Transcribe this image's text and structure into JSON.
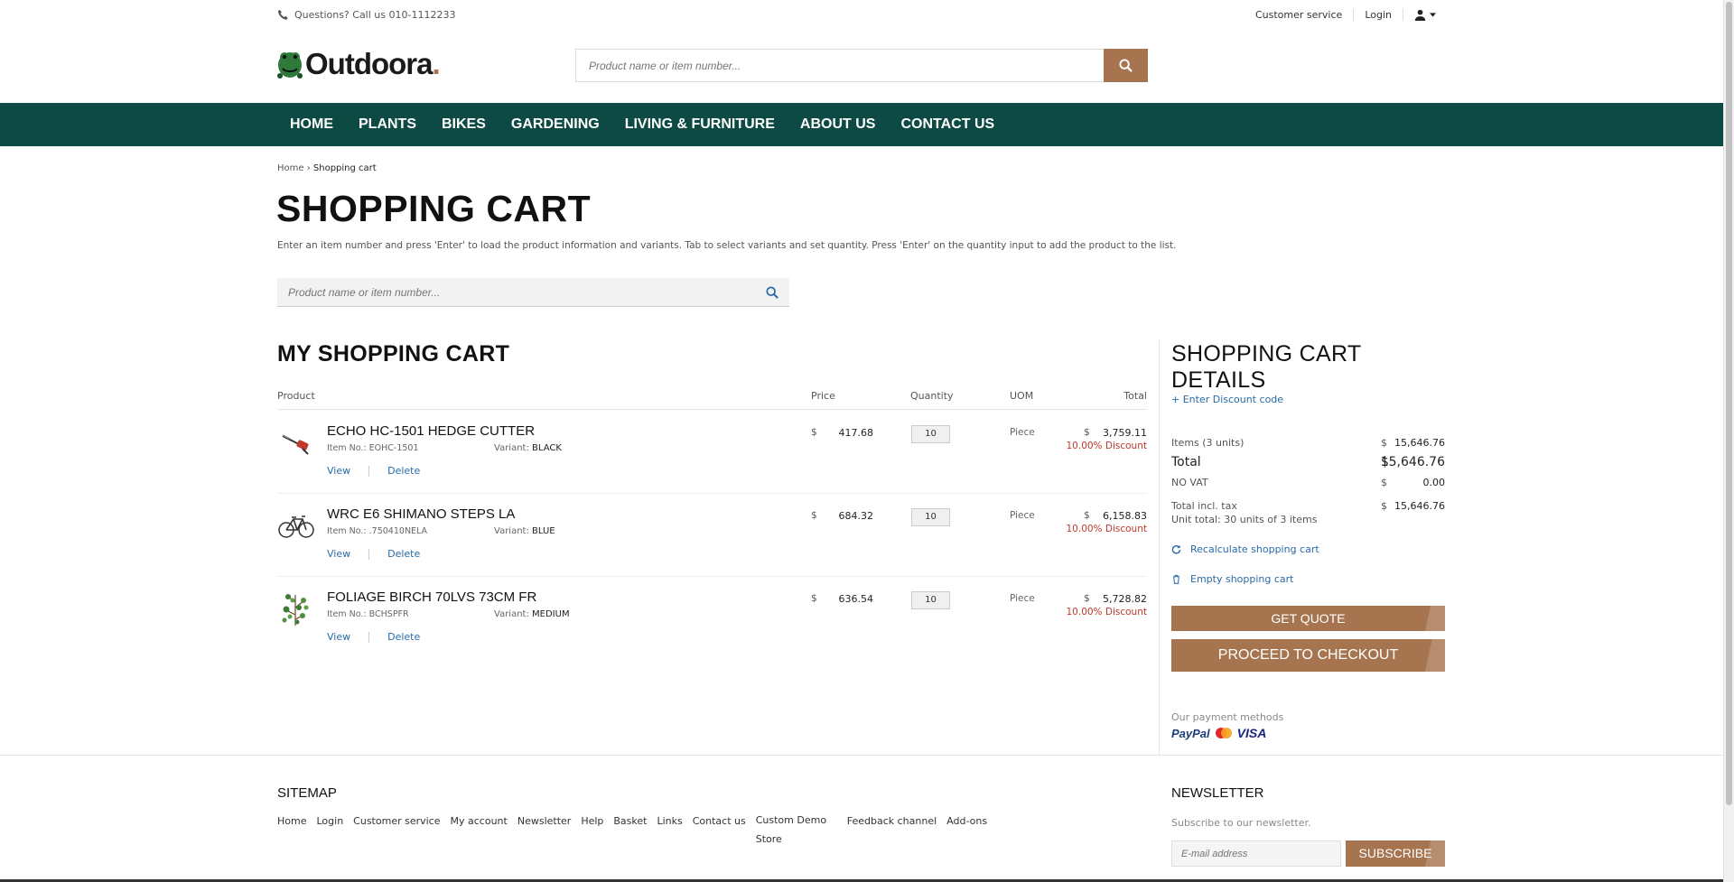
{
  "topbar": {
    "phone_text": "Questions? Call us 010-1112233",
    "customer_service": "Customer service",
    "login": "Login"
  },
  "brand": {
    "name": "Outdoora",
    "dot": ".",
    "color": "#a6754f"
  },
  "header_search": {
    "placeholder": "Product name or item number..."
  },
  "nav": {
    "items": [
      "HOME",
      "PLANTS",
      "BIKES",
      "GARDENING",
      "LIVING & FURNITURE",
      "ABOUT US",
      "CONTACT US"
    ],
    "background": "#0c4a43"
  },
  "breadcrumb": {
    "home": "Home",
    "separator": "›",
    "current": "Shopping cart"
  },
  "page": {
    "title": "SHOPPING CART",
    "instructions": "Enter an item number and press 'Enter' to load the product information and variants. Tab to select variants and set quantity. Press 'Enter' on the quantity input to add the product to the list.",
    "quick_search_placeholder": "Product name or item number..."
  },
  "cart": {
    "title": "MY SHOPPING CART",
    "columns": {
      "product": "Product",
      "price": "Price",
      "quantity": "Quantity",
      "uom": "UOM",
      "total": "Total"
    },
    "currency": "$",
    "item_no_label": "Item No.:",
    "variant_label": "Variant:",
    "view_label": "View",
    "delete_label": "Delete",
    "discount_suffix": "Discount",
    "items": [
      {
        "name": "ECHO HC-1501 HEDGE CUTTER",
        "item_no": "EOHC-1501",
        "variant": "BLACK",
        "price": "417.68",
        "quantity": "10",
        "uom": "Piece",
        "total": "3,759.11",
        "discount": "10.00%",
        "thumb_icon": "hedge-cutter-icon"
      },
      {
        "name": "WRC E6 SHIMANO STEPS LA",
        "item_no": ".750410NELA",
        "variant": "BLUE",
        "price": "684.32",
        "quantity": "10",
        "uom": "Piece",
        "total": "6,158.83",
        "discount": "10.00%",
        "thumb_icon": "bicycle-icon"
      },
      {
        "name": "FOLIAGE BIRCH 70LVS 73CM FR",
        "item_no": "BCHSPFR",
        "variant": "MEDIUM",
        "price": "636.54",
        "quantity": "10",
        "uom": "Piece",
        "total": "5,728.82",
        "discount": "10.00%",
        "thumb_icon": "foliage-icon"
      }
    ]
  },
  "details": {
    "title": "SHOPPING CART DETAILS",
    "discount_link": "+ Enter Discount code",
    "items_label": "Items (3 units)",
    "items_value": "15,646.76",
    "total_label": "Total",
    "total_value": "15,646.76",
    "vat_label": "NO VAT",
    "vat_value": "0.00",
    "incl_tax_label": "Total incl. tax",
    "incl_tax_value": "15,646.76",
    "unit_total": "Unit total: 30 units of 3 items",
    "recalculate": "Recalculate shopping cart",
    "empty": "Empty shopping cart",
    "get_quote": "GET QUOTE",
    "checkout": "PROCEED TO CHECKOUT",
    "payment_label": "Our payment methods",
    "payment_methods": [
      "PayPal",
      "Mastercard",
      "VISA"
    ]
  },
  "footer": {
    "sitemap_title": "SITEMAP",
    "sitemap_links": [
      "Home",
      "Login",
      "Customer service",
      "My account",
      "Newsletter",
      "Help",
      "Basket",
      "Links",
      "Contact us",
      "Custom Demo Store",
      "Feedback channel",
      "Add-ons"
    ],
    "newsletter_title": "NEWSLETTER",
    "newsletter_sub": "Subscribe to our newsletter.",
    "email_placeholder": "E-mail address",
    "subscribe": "SUBSCRIBE"
  }
}
